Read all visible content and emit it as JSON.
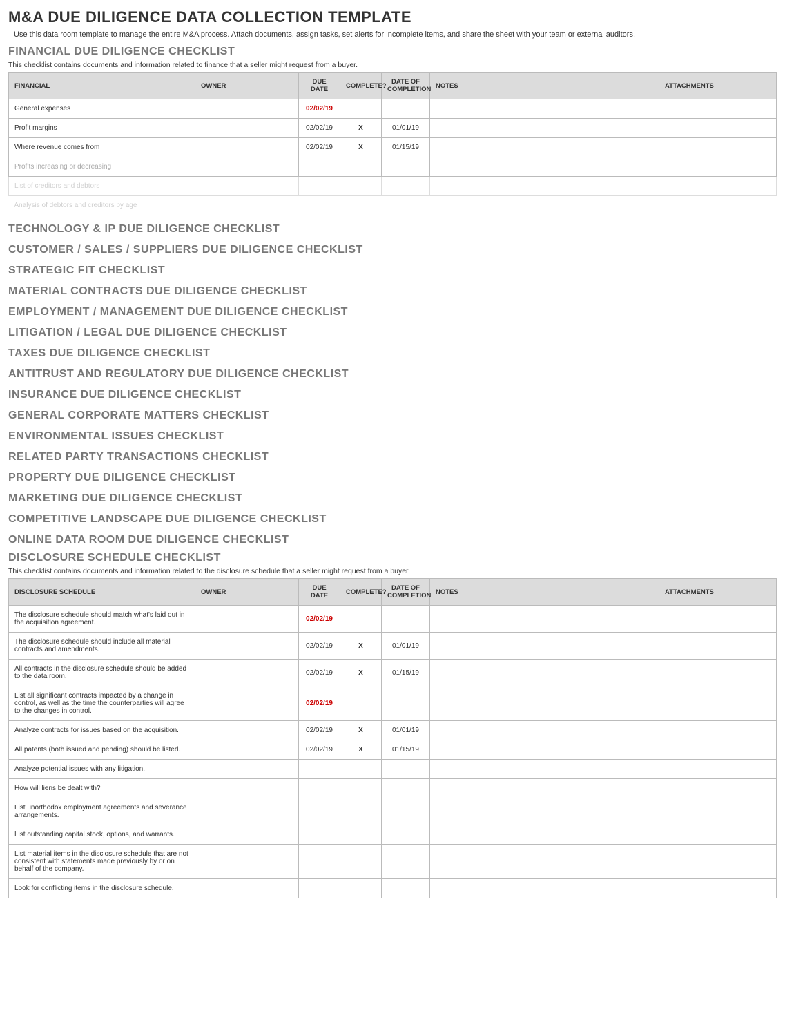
{
  "title": "M&A DUE DILIGENCE DATA COLLECTION TEMPLATE",
  "intro": "Use this data room template to manage the entire M&A process. Attach documents, assign tasks, set alerts for incomplete items, and share the sheet with your team or external auditors.",
  "financial": {
    "heading": "FINANCIAL DUE DILIGENCE CHECKLIST",
    "desc": "This checklist contains documents and information related to finance that a seller might request from a buyer.",
    "headers": {
      "item": "FINANCIAL",
      "owner": "OWNER",
      "due": "DUE DATE",
      "complete": "COMPLETE?",
      "dateCompleted": "DATE OF COMPLETION",
      "notes": "NOTES",
      "attachments": "ATTACHMENTS"
    },
    "rows": [
      {
        "item": "General expenses",
        "due": "02/02/19",
        "overdue": true
      },
      {
        "item": "Profit margins",
        "due": "02/02/19",
        "complete": "X",
        "dateCompleted": "01/01/19"
      },
      {
        "item": "Where revenue comes from",
        "due": "02/02/19",
        "complete": "X",
        "dateCompleted": "01/15/19"
      },
      {
        "item": "Profits increasing or decreasing",
        "fade": 1
      },
      {
        "item": "List of creditors and debtors",
        "fade": 2
      },
      {
        "item": "Analysis of debtors and creditors by age",
        "fade": 3
      }
    ]
  },
  "sections": [
    "TECHNOLOGY & IP DUE DILIGENCE CHECKLIST",
    "CUSTOMER / SALES / SUPPLIERS DUE DILIGENCE CHECKLIST",
    "STRATEGIC FIT CHECKLIST",
    "MATERIAL CONTRACTS DUE DILIGENCE CHECKLIST",
    "EMPLOYMENT / MANAGEMENT DUE DILIGENCE CHECKLIST",
    "LITIGATION / LEGAL DUE DILIGENCE CHECKLIST",
    "TAXES DUE DILIGENCE CHECKLIST",
    "ANTITRUST AND REGULATORY DUE DILIGENCE CHECKLIST",
    "INSURANCE DUE DILIGENCE CHECKLIST",
    "GENERAL CORPORATE MATTERS CHECKLIST",
    "ENVIRONMENTAL ISSUES CHECKLIST",
    "RELATED PARTY TRANSACTIONS CHECKLIST",
    "PROPERTY DUE DILIGENCE CHECKLIST",
    "MARKETING DUE DILIGENCE CHECKLIST",
    "COMPETITIVE LANDSCAPE DUE DILIGENCE CHECKLIST",
    "ONLINE DATA ROOM DUE DILIGENCE CHECKLIST"
  ],
  "disclosure": {
    "heading": "DISCLOSURE SCHEDULE CHECKLIST",
    "desc": "This checklist contains documents and information related to the disclosure schedule that a seller might request from a buyer.",
    "headers": {
      "item": "DISCLOSURE SCHEDULE",
      "owner": "OWNER",
      "due": "DUE DATE",
      "complete": "COMPLETE?",
      "dateCompleted": "DATE OF COMPLETION",
      "notes": "NOTES",
      "attachments": "ATTACHMENTS"
    },
    "rows": [
      {
        "item": "The disclosure schedule should match what's laid out in the acquisition agreement.",
        "due": "02/02/19",
        "overdue": true
      },
      {
        "item": "The disclosure schedule should include all material contracts and amendments.",
        "due": "02/02/19",
        "complete": "X",
        "dateCompleted": "01/01/19"
      },
      {
        "item": "All contracts in the disclosure schedule should be added to the data room.",
        "due": "02/02/19",
        "complete": "X",
        "dateCompleted": "01/15/19"
      },
      {
        "item": "List all significant contracts impacted by a change in control, as well as the time the counterparties will agree to the changes in control.",
        "due": "02/02/19",
        "overdue": true
      },
      {
        "item": "Analyze contracts for issues based on the acquisition.",
        "due": "02/02/19",
        "complete": "X",
        "dateCompleted": "01/01/19"
      },
      {
        "item": "All patents (both issued and pending) should be listed.",
        "due": "02/02/19",
        "complete": "X",
        "dateCompleted": "01/15/19"
      },
      {
        "item": "Analyze potential issues with any litigation."
      },
      {
        "item": "How will liens be dealt with?"
      },
      {
        "item": "List unorthodox employment agreements and severance arrangements."
      },
      {
        "item": "List outstanding capital stock, options, and warrants."
      },
      {
        "item": "List material items in the disclosure schedule that are not consistent with statements made previously by or on behalf of the company."
      },
      {
        "item": "Look for conflicting items in the disclosure schedule."
      }
    ]
  }
}
